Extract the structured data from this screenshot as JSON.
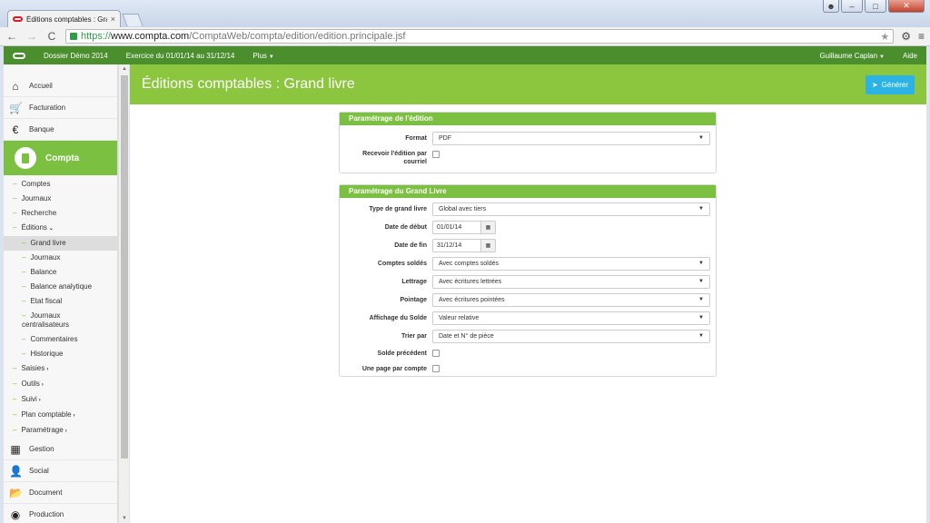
{
  "browser": {
    "tab_title": "Éditions comptables : Gra",
    "tab_close": "×",
    "url_scheme": "https://",
    "url_host": "www.compta.com",
    "url_path": "/ComptaWeb/compta/edition/edition.principale.jsf",
    "back": "←",
    "forward": "→",
    "reload": "C",
    "star": "★",
    "settings": "⚙",
    "menu": "≡",
    "win_min": "–",
    "win_max": "□",
    "win_close": "✕"
  },
  "appbar": {
    "dossier": "Dossier Démo 2014",
    "exercice": "Exercice du 01/01/14 au 31/12/14",
    "plus": "Plus",
    "user": "Guillaume Caplan",
    "aide": "Aide"
  },
  "sidebar": {
    "top": [
      {
        "label": "Accueil",
        "icon": "⌂"
      },
      {
        "label": "Facturation",
        "icon": "🛒"
      },
      {
        "label": "Banque",
        "icon": "€"
      }
    ],
    "compta": "Compta",
    "compta_sub": [
      "Comptes",
      "Journaux",
      "Recherche",
      "Éditions"
    ],
    "editions_sub": [
      "Grand livre",
      "Journaux",
      "Balance",
      "Balance analytique",
      "Etat fiscal",
      "Journaux centralisateurs",
      "Commentaires",
      "Historique"
    ],
    "compta_sub2": [
      "Saisies",
      "Outils",
      "Suivi",
      "Plan comptable",
      "Paramétrage"
    ],
    "bottom": [
      {
        "label": "Gestion",
        "icon": "▦"
      },
      {
        "label": "Social",
        "icon": "👤"
      },
      {
        "label": "Document",
        "icon": "📂"
      },
      {
        "label": "Production",
        "icon": "◉"
      }
    ]
  },
  "main": {
    "title": "Éditions comptables : Grand livre",
    "generate": "Générer",
    "panel1": {
      "title": "Paramétrage de l'édition",
      "format_label": "Format",
      "format_value": "PDF",
      "recevoir_label": "Recevoir l'édition par courriel"
    },
    "panel2": {
      "title": "Paramétrage du Grand Livre",
      "type_label": "Type de grand livre",
      "type_value": "Global avec tiers",
      "debut_label": "Date de début",
      "debut_value": "01/01/14",
      "fin_label": "Date de fin",
      "fin_value": "31/12/14",
      "soldes_label": "Comptes soldés",
      "soldes_value": "Avec comptes soldés",
      "lettrage_label": "Lettrage",
      "lettrage_value": "Avec écritures lettrées",
      "pointage_label": "Pointage",
      "pointage_value": "Avec écritures pointées",
      "affichage_label": "Affichage du Solde",
      "affichage_value": "Valeur relative",
      "trier_label": "Trier par",
      "trier_value": "Date et N° de pièce",
      "solde_prec_label": "Solde précédent",
      "une_page_label": "Une page par compte"
    }
  }
}
